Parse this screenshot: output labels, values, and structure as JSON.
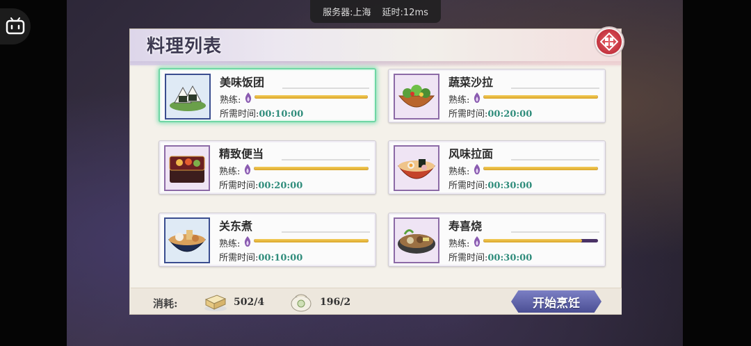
{
  "status": {
    "server": "服务器:上海",
    "latency": "延时:12ms"
  },
  "panel": {
    "title": "料理列表"
  },
  "labels": {
    "proficiency": "熟练:",
    "time_needed": "所需时间:"
  },
  "recipes": [
    {
      "name": "美味饭团",
      "time": "00:10:00",
      "proficiency": 1.0,
      "selected": true,
      "icon": "onigiri-icon"
    },
    {
      "name": "蔬菜沙拉",
      "time": "00:20:00",
      "proficiency": 1.0,
      "selected": false,
      "icon": "salad-icon"
    },
    {
      "name": "精致便当",
      "time": "00:20:00",
      "proficiency": 1.0,
      "selected": false,
      "icon": "bento-icon"
    },
    {
      "name": "风味拉面",
      "time": "00:30:00",
      "proficiency": 1.0,
      "selected": false,
      "icon": "ramen-icon"
    },
    {
      "name": "关东煮",
      "time": "00:10:00",
      "proficiency": 1.0,
      "selected": false,
      "icon": "oden-icon"
    },
    {
      "name": "寿喜烧",
      "time": "00:30:00",
      "proficiency": 0.86,
      "selected": false,
      "icon": "sukiyaki-icon"
    }
  ],
  "footer": {
    "cost_label": "消耗:",
    "resource1": {
      "value": "502/4",
      "icon": "rice-box-icon"
    },
    "resource2": {
      "value": "196/2",
      "icon": "seasoning-bag-icon"
    },
    "start_button": "开始烹饪"
  }
}
